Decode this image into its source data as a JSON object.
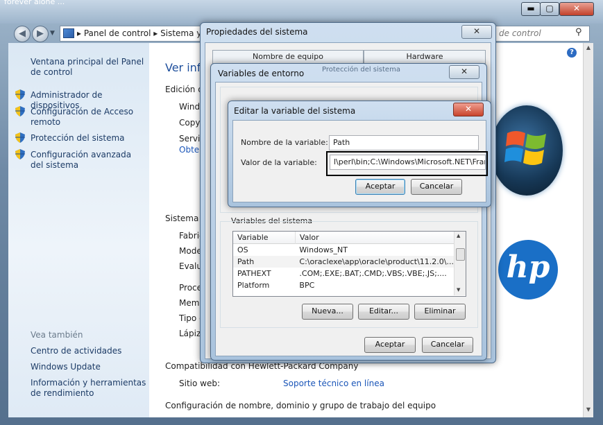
{
  "main_window": {
    "title_fragment": "forever alone ...",
    "window_buttons": {
      "minimize": "▬",
      "maximize": "▢",
      "close": "✕"
    },
    "breadcrumb": [
      "Panel de control",
      "Sistema y"
    ],
    "search_placeholder": "de control"
  },
  "sidebar": {
    "home_link": "Ventana principal del Panel de control",
    "links": [
      "Administrador de dispositivos",
      "Configuración de Acceso remoto",
      "Protección del sistema",
      "Configuración avanzada del sistema"
    ],
    "see_also_heading": "Vea también",
    "see_also": [
      "Centro de actividades",
      "Windows Update",
      "Información y herramientas de rendimiento"
    ]
  },
  "content": {
    "heading_partial": "Ver info",
    "edition_partial": "Edición d",
    "edition_rows": [
      "Windo",
      "Copy",
      "Servi",
      "Obten"
    ],
    "system_heading": "Sistema",
    "system_rows": [
      "Fabric",
      "Mode",
      "Evalua",
      "Proce",
      "Memo",
      "Tipo d",
      "Lápiz"
    ],
    "compat_heading": "Compatibilidad con Hewlett-Packard Company",
    "website_label": "Sitio web:",
    "website_link": "Soporte técnico en línea",
    "config_heading": "Configuración de nombre, dominio y grupo de trabajo del equipo",
    "hp_logo_text": "hp"
  },
  "system_properties": {
    "title": "Propiedades del sistema",
    "tabs": [
      "Nombre de equipo",
      "Hardware"
    ],
    "tab_row2_fragment": "Protección del sistema",
    "close": "✕"
  },
  "env_vars": {
    "title": "Variables de entorno",
    "close": "✕",
    "system_vars_label": "Variables del sistema",
    "columns": [
      "Variable",
      "Valor"
    ],
    "rows": [
      {
        "name": "OS",
        "value": "Windows_NT"
      },
      {
        "name": "Path",
        "value": "C:\\oraclexe\\app\\oracle\\product\\11.2.0\\..."
      },
      {
        "name": "PATHEXT",
        "value": ".COM;.EXE;.BAT;.CMD;.VBS;.VBE;.JS;...."
      },
      {
        "name": "Platform",
        "value": "BPC"
      }
    ],
    "buttons": {
      "new": "Nueva...",
      "edit": "Editar...",
      "delete": "Eliminar"
    },
    "ok": "Aceptar",
    "cancel": "Cancelar"
  },
  "edit_var": {
    "title": "Editar la variable del sistema",
    "close": "✕",
    "name_label": "Nombre de la variable:",
    "name_value": "Path",
    "value_label": "Valor de la variable:",
    "value_value": "l\\perl\\bin;C:\\Windows\\Microsoft.NET\\Frame",
    "ok": "Aceptar",
    "cancel": "Cancelar"
  },
  "colors": {
    "link": "#1c3b66",
    "link_blue": "#1a55b8",
    "highlight_box": "#000000"
  }
}
